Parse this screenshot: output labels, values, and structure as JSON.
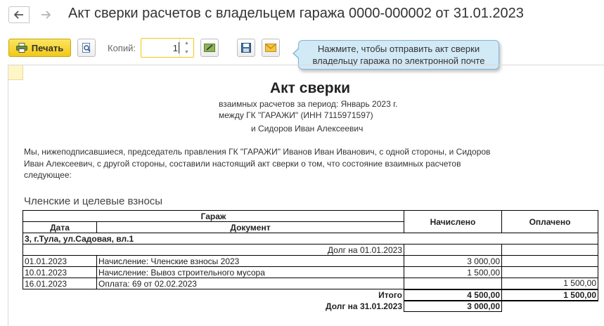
{
  "window": {
    "title": "Акт сверки расчетов с владельцем гаража 0000-000002 от 31.01.2023",
    "back_icon": "arrow-left-icon",
    "forward_icon": "arrow-right-icon"
  },
  "toolbar": {
    "print_label": "Печать",
    "copies_label": "Копий:",
    "copies_value": "1",
    "tooltip": "Нажмите, чтобы отправить акт сверки владельцу гаража по электронной почте",
    "icons": [
      "printer-icon",
      "preview-icon",
      "edit-icon",
      "save-icon",
      "envelope-icon"
    ]
  },
  "document": {
    "title": "Акт сверки",
    "header_line1": "взаимных расчетов за период: Январь 2023 г.",
    "header_line2": "между ГК \"ГАРАЖИ\" (ИНН 7115971597)",
    "header_line3": "и Сидоров Иван Алексеевич",
    "paragraph": "Мы, нижеподписавшиеся, председатель правления ГК \"ГАРАЖИ\" Иванов Иван Иванович, с одной стороны, и Сидоров Иван Алексеевич, с другой стороны, составили настоящий акт сверки о том, что состояние взаимных расчетов следующее:",
    "section_title": "Членские и целевые взносы",
    "table": {
      "header_garage": "Гараж",
      "header_date": "Дата",
      "header_document": "Документ",
      "header_accrued": "Начислено",
      "header_paid": "Оплачено",
      "garage_name": "3, г.Тула, ул.Садовая, вл.1",
      "opening_label": "Долг на 01.01.2023",
      "rows": [
        {
          "date": "01.01.2023",
          "document": "Начисление: Членские взносы 2023",
          "accrued": "3 000,00",
          "paid": ""
        },
        {
          "date": "10.01.2023",
          "document": "Начисление: Вывоз строительного мусора",
          "accrued": "1 500,00",
          "paid": ""
        },
        {
          "date": "16.01.2023",
          "document": "Оплата: 69 от 02.02.2023",
          "accrued": "",
          "paid": "1 500,00"
        }
      ],
      "total_label": "Итого",
      "total_accrued": "4 500,00",
      "total_paid": "1 500,00",
      "closing_label": "Долг на 31.01.2023",
      "closing_value": "3 000,00"
    }
  }
}
